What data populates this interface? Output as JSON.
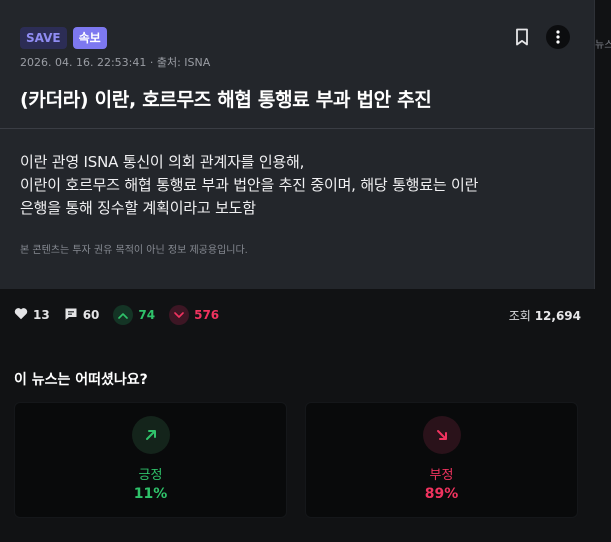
{
  "article": {
    "badges": {
      "save": "SAVE",
      "breaking": "속보"
    },
    "meta": "2026. 04. 16. 22:53:41 · 출처: ISNA",
    "title": "(카더라) 이란, 호르무즈 해협 통행료 부과 법안 추진",
    "body_lines": [
      "이란 관영 ISNA 통신이 의회 관계자를 인용해,",
      "이란이 호르무즈 해협 통행료 부과 법안을 추진 중이며, 해당 통행료는 이란",
      "은행을 통해 징수할 계획이라고 보도함"
    ],
    "disclaimer": "본 콘텐츠는 투자 권유 목적이 아닌 정보 제공용입니다.",
    "icons": {
      "bookmark": "bookmark-icon",
      "more": "more-vertical-icon"
    }
  },
  "stats": {
    "likes": "13",
    "comments": "60",
    "up": "74",
    "down": "576",
    "views_label": "조회",
    "views": "12,694"
  },
  "sidebar_peek": "뉴스",
  "sentiment": {
    "question": "이 뉴스는 어떠셨나요?",
    "positive": {
      "label": "긍정",
      "percent": "11%"
    },
    "negative": {
      "label": "부정",
      "percent": "89%"
    }
  },
  "colors": {
    "positive": "#2fc26a",
    "negative": "#f0335f",
    "accent": "#7d78f0"
  }
}
